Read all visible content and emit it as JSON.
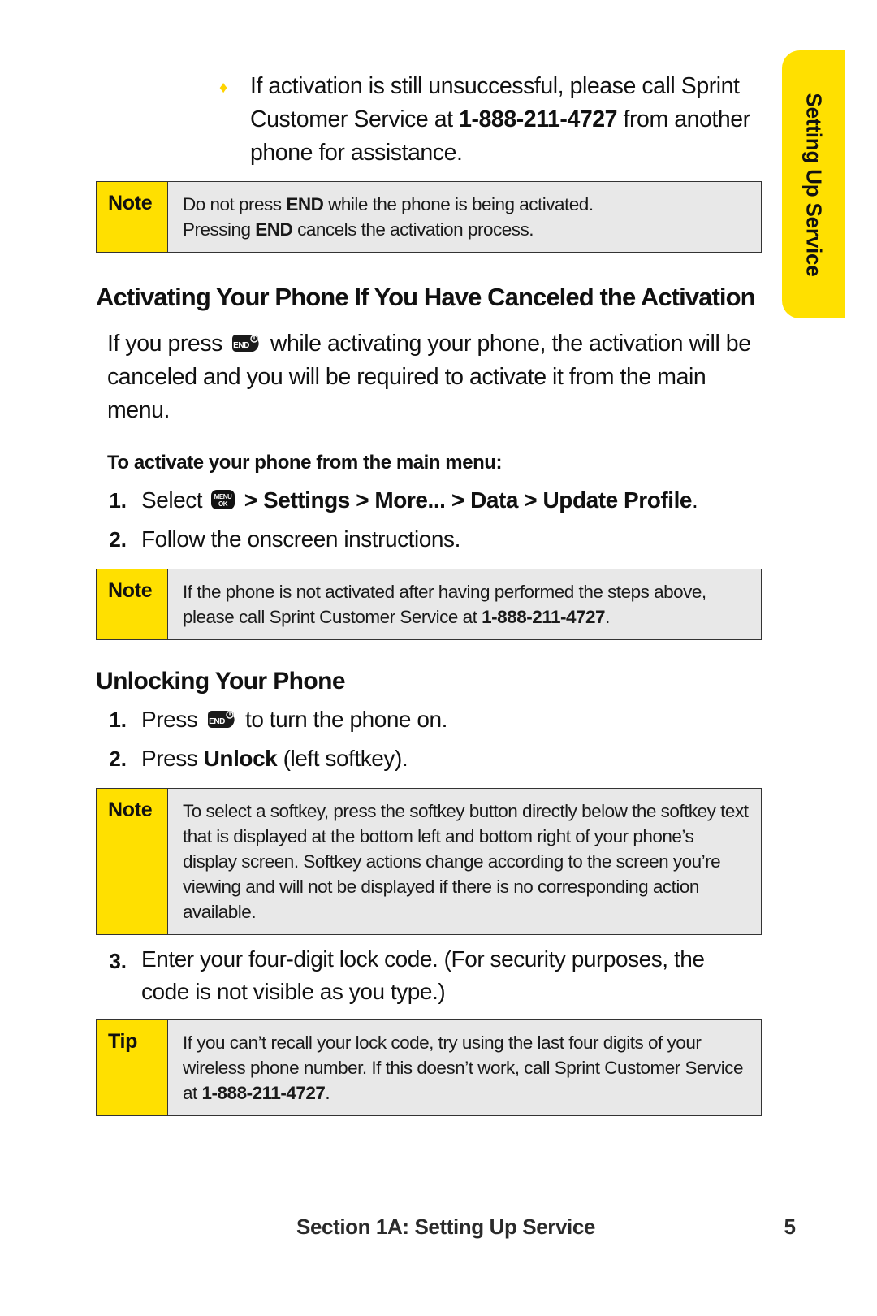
{
  "side_tab": {
    "label": "Setting Up Service",
    "color": "#FFE000"
  },
  "bullet": {
    "marker": "♦",
    "text_1": "If activation is still unsuccessful, please call Sprint Customer Service at ",
    "phone": "1-888-211-4727",
    "text_2": " from another phone for assistance."
  },
  "note_1": {
    "label": "Note",
    "line1_a": "Do not press ",
    "line1_key": "END",
    "line1_b": " while the phone is being activated.",
    "line2_a": "Pressing ",
    "line2_key": "END",
    "line2_b": " cancels the activation process."
  },
  "heading_activating": "Activating Your Phone If You Have Canceled the Activation",
  "para_activating": {
    "before_icon": "If you press ",
    "icon_name": "end-key",
    "after_icon": " while activating your phone, the activation will be canceled and you will be required to activate it from the main menu."
  },
  "lead_in_activate": "To activate your phone from the main menu:",
  "steps_activate": [
    {
      "num": "1.",
      "before_icon": "Select ",
      "icon_name": "menu-ok-key",
      "path": " > Settings > More... > Data > Update Profile",
      "after": "."
    },
    {
      "num": "2.",
      "text": "Follow the onscreen instructions."
    }
  ],
  "note_2": {
    "label": "Note",
    "text_a": "If the phone is not activated after having performed the steps above, please call Sprint Customer Service at ",
    "phone": "1-888-211-4727",
    "text_b": "."
  },
  "heading_unlocking": "Unlocking Your Phone",
  "steps_unlocking": [
    {
      "num": "1.",
      "before_icon": "Press ",
      "icon_name": "end-key",
      "after_icon": " to turn the phone on."
    },
    {
      "num": "2.",
      "before_bold": "Press ",
      "bold": "Unlock",
      "after_bold": " (left softkey)."
    }
  ],
  "note_3": {
    "label": "Note",
    "text": "To select a softkey, press the softkey button directly below the softkey text that is displayed at the bottom left and bottom right of your phone’s display screen. Softkey actions change according to the screen you’re viewing and will not be displayed if there is no corresponding action available."
  },
  "step_3": {
    "num": "3.",
    "text": "Enter your four-digit lock code. (For security purposes, the code is not visible as you type.)"
  },
  "tip": {
    "label": "Tip",
    "text_a": "If you can’t recall your lock code, try using the last four digits of your wireless phone number. If this doesn’t work, call Sprint Customer Service at ",
    "phone": "1-888-211-4727",
    "text_b": "."
  },
  "footer": {
    "title": "Section 1A: Setting Up Service",
    "page": "5"
  },
  "icons": {
    "end_key_label": "END",
    "menu_key_label_top": "MENU",
    "menu_key_label_bottom": "OK"
  }
}
